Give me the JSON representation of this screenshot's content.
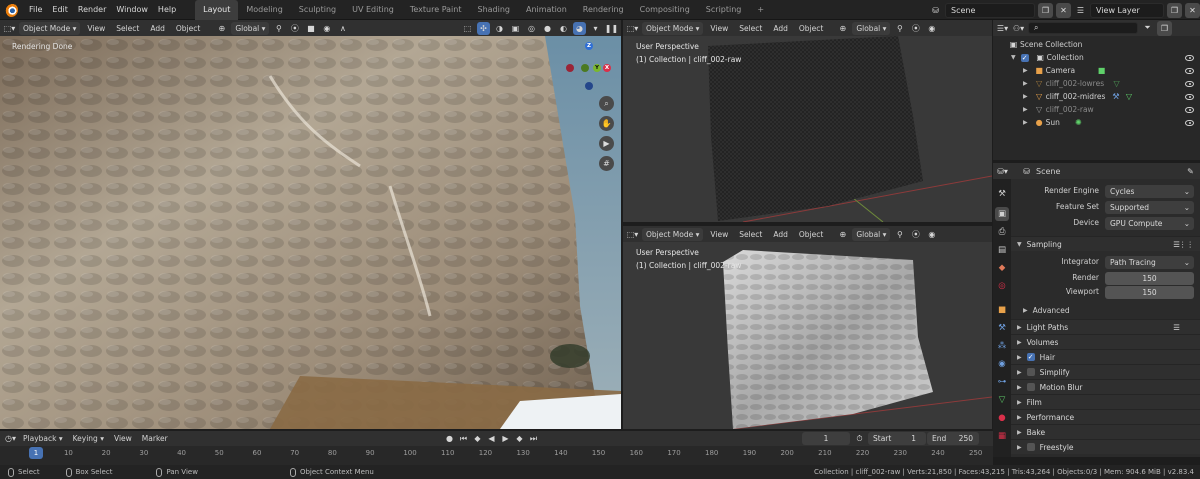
{
  "top_menu": [
    "File",
    "Edit",
    "Render",
    "Window",
    "Help"
  ],
  "workspaces": [
    "Layout",
    "Modeling",
    "Sculpting",
    "UV Editing",
    "Texture Paint",
    "Shading",
    "Animation",
    "Rendering",
    "Compositing",
    "Scripting"
  ],
  "active_workspace": "Layout",
  "add_workspace": "+",
  "scene_name": "Scene",
  "view_layer": "View Layer",
  "viewport_main": {
    "mode": "Object Mode",
    "menus": [
      "View",
      "Select",
      "Add",
      "Object"
    ],
    "orientation": "Global",
    "status_text": "Rendering Done",
    "gizmo": {
      "z": "Z",
      "y": "Y",
      "x": "X"
    }
  },
  "viewport_top_right": {
    "mode": "Object Mode",
    "menus": [
      "View",
      "Select",
      "Add",
      "Object"
    ],
    "orientation": "Global",
    "perspective": "User Perspective",
    "collection_info": "(1) Collection | cliff_002-raw"
  },
  "viewport_bottom_right": {
    "mode": "Object Mode",
    "menus": [
      "View",
      "Select",
      "Add",
      "Object"
    ],
    "orientation": "Global",
    "perspective": "User Perspective",
    "collection_info": "(1) Collection | cliff_002-raw"
  },
  "outliner": {
    "root": "Scene Collection",
    "collection": "Collection",
    "items": [
      {
        "name": "Camera",
        "dim": false
      },
      {
        "name": "cliff_002-lowres",
        "dim": true
      },
      {
        "name": "cliff_002-midres",
        "dim": false
      },
      {
        "name": "cliff_002-raw",
        "dim": true
      },
      {
        "name": "Sun",
        "dim": false
      }
    ]
  },
  "properties": {
    "context": "Scene",
    "render_engine_label": "Render Engine",
    "render_engine": "Cycles",
    "feature_set_label": "Feature Set",
    "feature_set": "Supported",
    "device_label": "Device",
    "device": "GPU Compute",
    "sampling": "Sampling",
    "integrator_label": "Integrator",
    "integrator": "Path Tracing",
    "render_label": "Render",
    "render_samples": "150",
    "viewport_label": "Viewport",
    "viewport_samples": "150",
    "advanced": "Advanced",
    "panels": [
      {
        "label": "Light Paths",
        "checkbox": null
      },
      {
        "label": "Volumes",
        "checkbox": null
      },
      {
        "label": "Hair",
        "checkbox": true
      },
      {
        "label": "Simplify",
        "checkbox": false
      },
      {
        "label": "Motion Blur",
        "checkbox": false
      },
      {
        "label": "Film",
        "checkbox": null
      },
      {
        "label": "Performance",
        "checkbox": null
      },
      {
        "label": "Bake",
        "checkbox": null
      },
      {
        "label": "Freestyle",
        "checkbox": false
      }
    ]
  },
  "timeline": {
    "menus": [
      "Playback",
      "Keying",
      "View",
      "Marker"
    ],
    "current_frame": "1",
    "start_label": "Start",
    "start": "1",
    "end_label": "End",
    "end": "250",
    "ticks": [
      "1",
      "10",
      "20",
      "30",
      "40",
      "50",
      "60",
      "70",
      "80",
      "90",
      "100",
      "110",
      "120",
      "130",
      "140",
      "150",
      "160",
      "170",
      "180",
      "190",
      "200",
      "210",
      "220",
      "230",
      "240",
      "250"
    ],
    "playhead_frame": 1
  },
  "statusbar": {
    "select": "Select",
    "box_select": "Box Select",
    "pan_view": "Pan View",
    "context_menu": "Object Context Menu",
    "stats": "Collection | cliff_002-raw | Verts:21,850 | Faces:43,215 | Tris:43,264 | Objects:0/3 | Mem: 904.6 MiB | v2.83.4"
  },
  "colors": {
    "accent": "#4772b3",
    "active_tab": "#3d3d3d",
    "object_orange": "#e8a14a",
    "mesh_green": "#5fd16a"
  }
}
